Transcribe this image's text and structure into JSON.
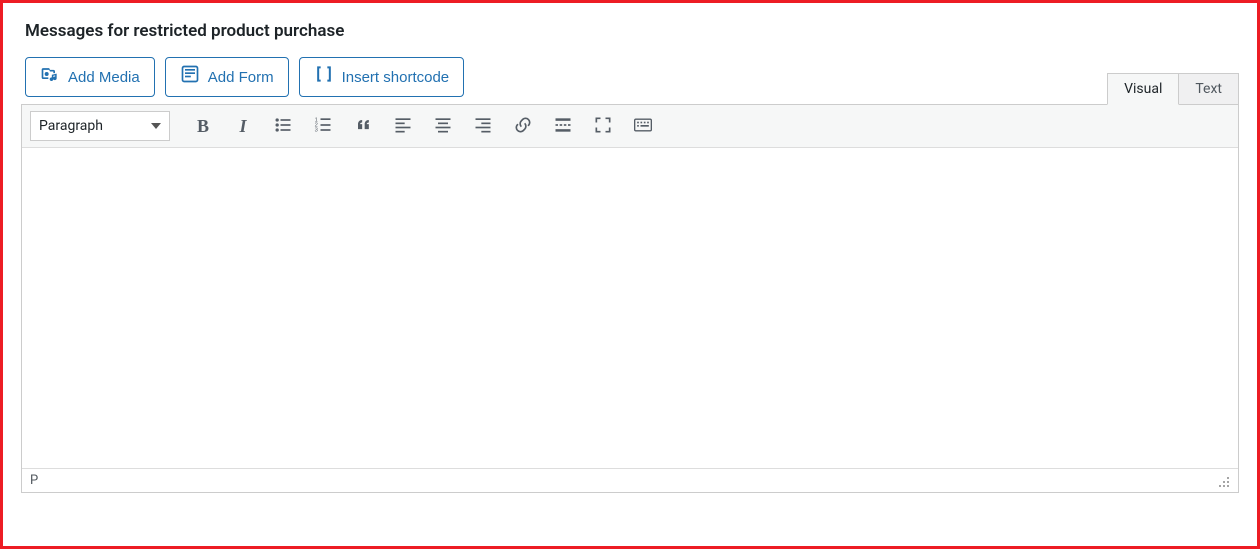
{
  "section": {
    "title": "Messages for restricted product purchase"
  },
  "buttons": {
    "add_media": "Add Media",
    "add_form": "Add Form",
    "insert_shortcode": "Insert shortcode"
  },
  "tabs": {
    "visual": "Visual",
    "text": "Text",
    "active": "visual"
  },
  "toolbar": {
    "format_selected": "Paragraph"
  },
  "editor": {
    "content": "",
    "path": "P"
  }
}
